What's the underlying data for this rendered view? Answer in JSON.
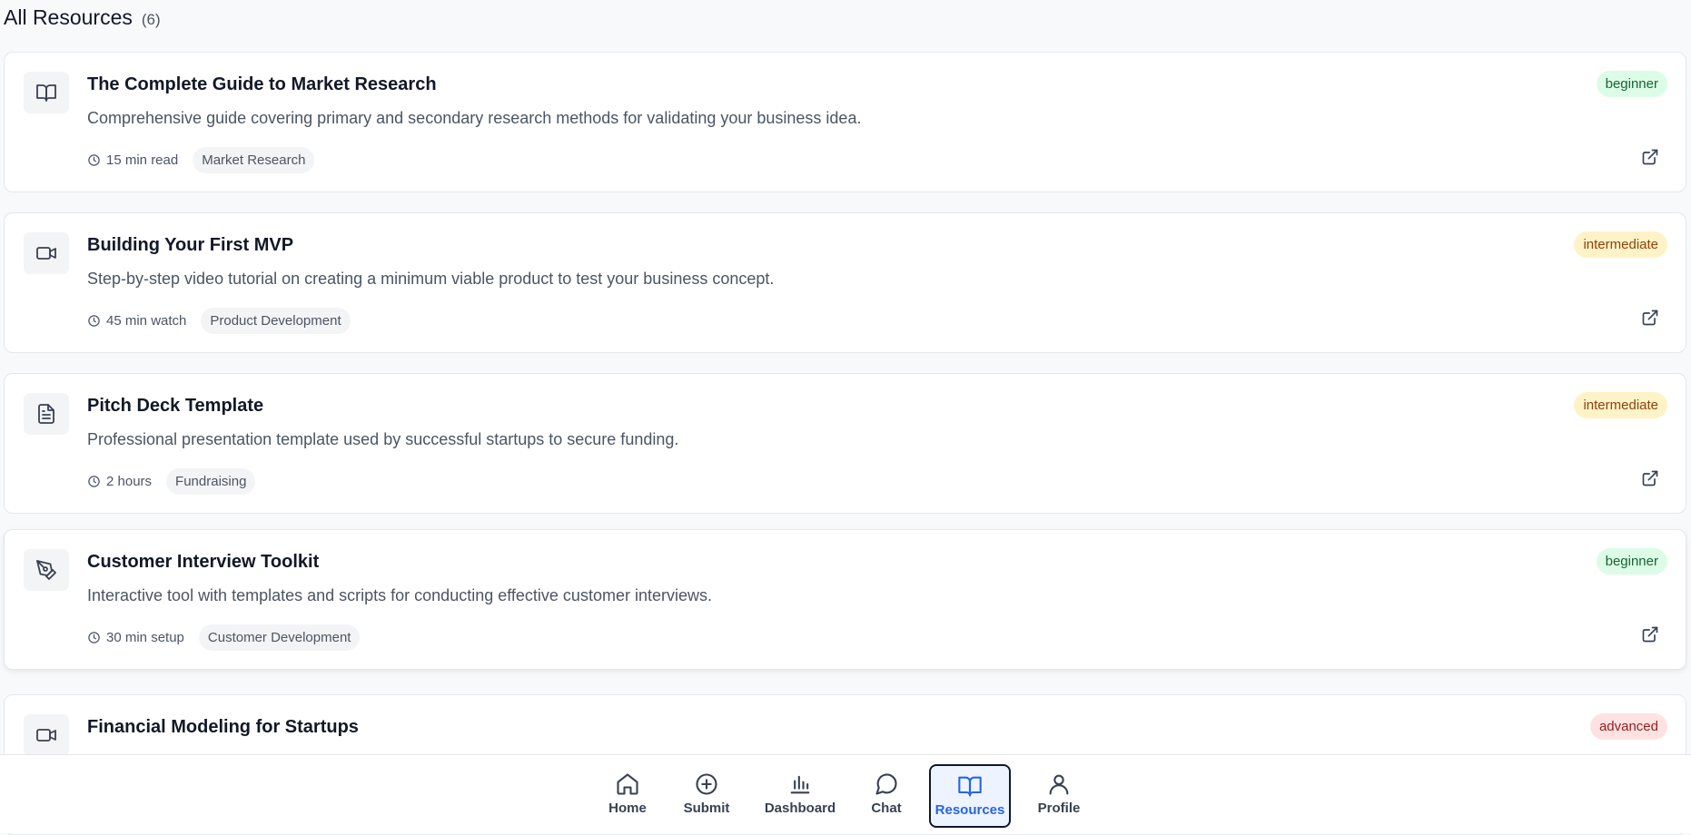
{
  "header": {
    "title": "All Resources",
    "count": "(6)"
  },
  "resources": [
    {
      "icon": "book-open-icon",
      "title": "The Complete Guide to Market Research",
      "description": "Comprehensive guide covering primary and secondary research methods for validating your business idea.",
      "duration": "15 min read",
      "tag": "Market Research",
      "level": "beginner"
    },
    {
      "icon": "video-icon",
      "title": "Building Your First MVP",
      "description": "Step-by-step video tutorial on creating a minimum viable product to test your business concept.",
      "duration": "45 min watch",
      "tag": "Product Development",
      "level": "intermediate"
    },
    {
      "icon": "document-icon",
      "title": "Pitch Deck Template",
      "description": "Professional presentation template used by successful startups to secure funding.",
      "duration": "2 hours",
      "tag": "Fundraising",
      "level": "intermediate"
    },
    {
      "icon": "pen-tool-icon",
      "title": "Customer Interview Toolkit",
      "description": "Interactive tool with templates and scripts for conducting effective customer interviews.",
      "duration": "30 min setup",
      "tag": "Customer Development",
      "level": "beginner"
    },
    {
      "icon": "video-icon",
      "title": "Financial Modeling for Startups",
      "level": "advanced"
    }
  ],
  "nav": {
    "items": [
      {
        "label": "Home",
        "icon": "home-icon"
      },
      {
        "label": "Submit",
        "icon": "plus-circle-icon"
      },
      {
        "label": "Dashboard",
        "icon": "bar-chart-icon"
      },
      {
        "label": "Chat",
        "icon": "chat-bubble-icon"
      },
      {
        "label": "Resources",
        "icon": "book-open-icon",
        "active": true
      },
      {
        "label": "Profile",
        "icon": "user-icon"
      }
    ]
  },
  "colors": {
    "accent": "#2563eb",
    "beginner": "#166534",
    "intermediate": "#92400e",
    "advanced": "#991b1b"
  }
}
